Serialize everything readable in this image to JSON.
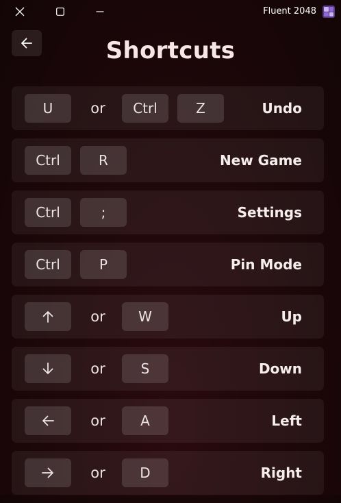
{
  "window": {
    "app_title": "Fluent 2048",
    "close_icon": "close-icon",
    "maximize_icon": "maximize-icon",
    "minimize_icon": "minimize-icon"
  },
  "header": {
    "back_icon": "arrow-left-icon",
    "title": "Shortcuts"
  },
  "shortcuts": [
    {
      "keys": [
        "U",
        "Ctrl",
        "Z"
      ],
      "separators": [
        "or"
      ],
      "action": "Undo"
    },
    {
      "keys": [
        "Ctrl",
        "R"
      ],
      "action": "New Game"
    },
    {
      "keys": [
        "Ctrl",
        ";"
      ],
      "action": "Settings"
    },
    {
      "keys": [
        "Ctrl",
        "P"
      ],
      "action": "Pin Mode"
    },
    {
      "keys": [
        "arrow-up-icon",
        "W"
      ],
      "separators": [
        "or"
      ],
      "action": "Up"
    },
    {
      "keys": [
        "arrow-down-icon",
        "S"
      ],
      "separators": [
        "or"
      ],
      "action": "Down"
    },
    {
      "keys": [
        "arrow-left-icon",
        "A"
      ],
      "separators": [
        "or"
      ],
      "action": "Left"
    },
    {
      "keys": [
        "arrow-right-icon",
        "D"
      ],
      "separators": [
        "or"
      ],
      "action": "Right"
    }
  ],
  "colors": {
    "background": "#1c0709",
    "row_background": "#2a1a1b",
    "key_background": "#463638",
    "text": "#f3ecec"
  }
}
